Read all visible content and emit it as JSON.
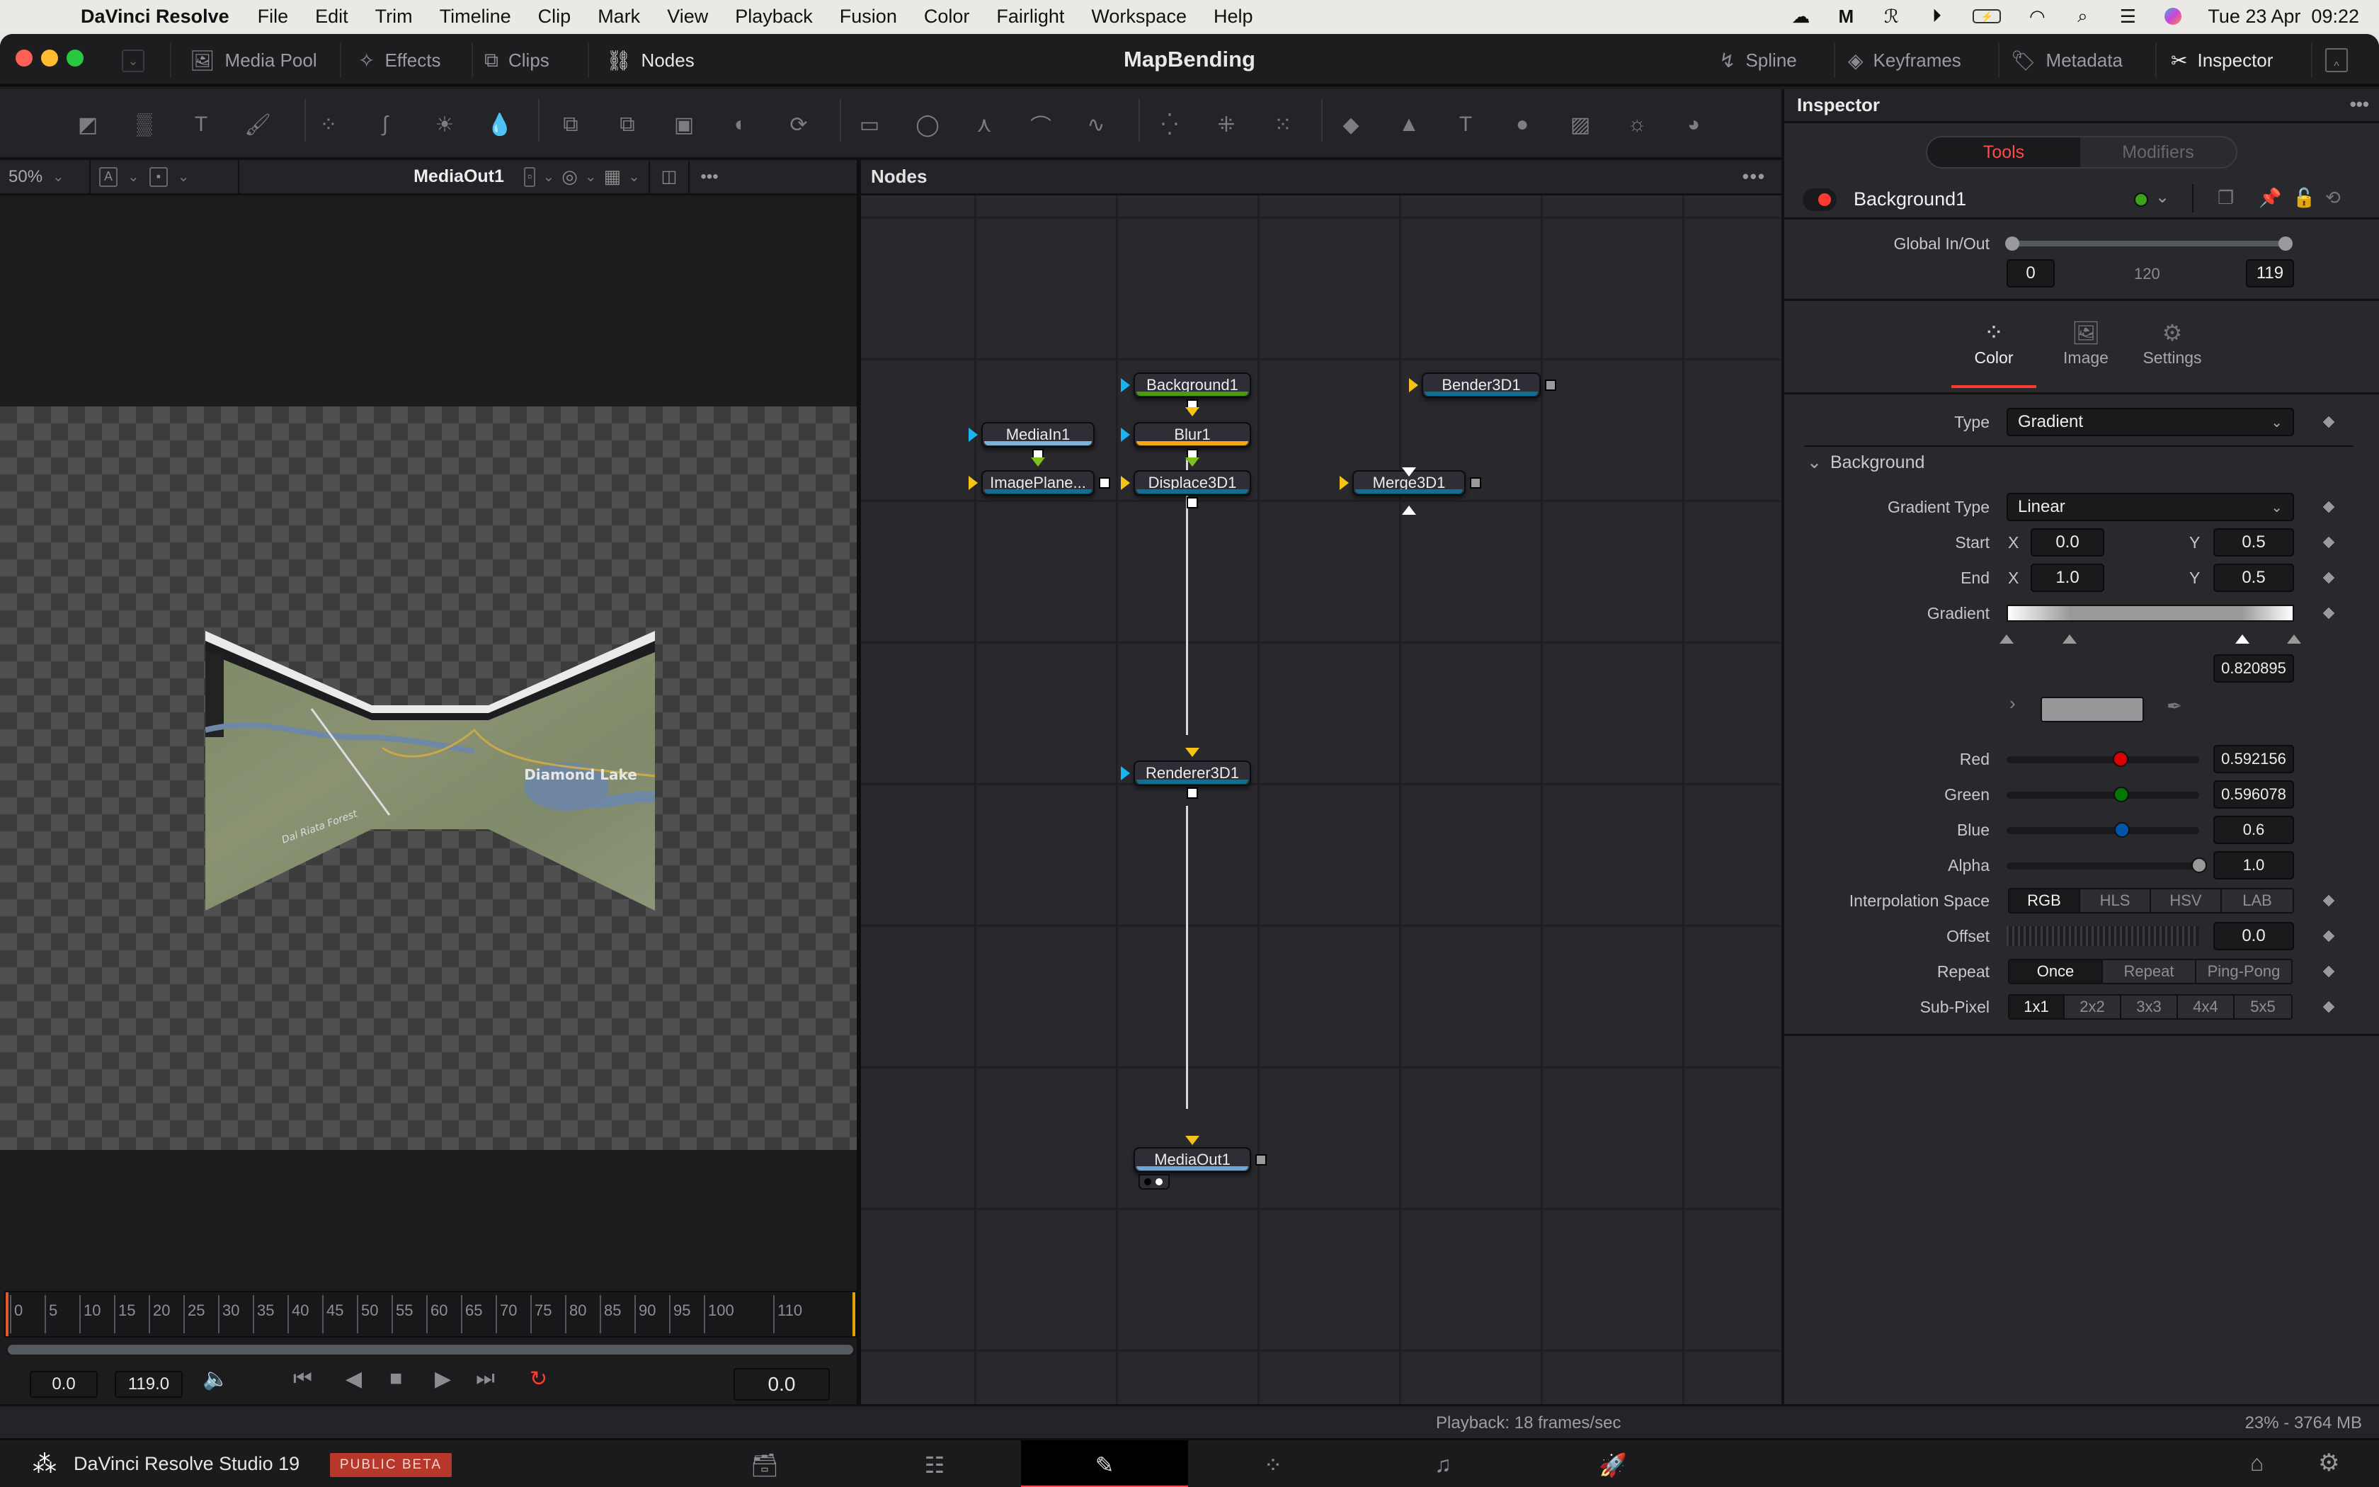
{
  "menubar": {
    "app": "DaVinci Resolve",
    "items": [
      "File",
      "Edit",
      "Trim",
      "Timeline",
      "Clip",
      "Mark",
      "View",
      "Playback",
      "Fusion",
      "Color",
      "Fairlight",
      "Workspace",
      "Help"
    ],
    "clock": "Tue 23 Apr  09:22",
    "status_icons": [
      "cloud-icon",
      "m-logo-icon",
      "scribble-icon",
      "play-circle-icon",
      "battery-icon",
      "wifi-icon",
      "search-icon",
      "control-center-icon",
      "siri-icon"
    ]
  },
  "topbar": {
    "title": "MapBending",
    "left_buttons": [
      {
        "label": "Media Pool",
        "icon": "media-pool-icon"
      },
      {
        "label": "Effects",
        "icon": "effects-icon"
      },
      {
        "label": "Clips",
        "icon": "clips-icon"
      },
      {
        "label": "Nodes",
        "icon": "nodes-icon",
        "active": true
      }
    ],
    "right_buttons": [
      {
        "label": "Spline",
        "icon": "spline-icon"
      },
      {
        "label": "Keyframes",
        "icon": "keyframes-icon"
      },
      {
        "label": "Metadata",
        "icon": "metadata-icon"
      },
      {
        "label": "Inspector",
        "icon": "inspector-icon",
        "active": true
      }
    ]
  },
  "toolbar": {
    "tools": [
      "background-tool",
      "fast-noise-tool",
      "text-tool",
      "paint-tool",
      "color-corrector-tool",
      "color-curves-tool",
      "brightness-contrast-tool",
      "matte-control-tool",
      "merge-tool",
      "dissolve-tool",
      "channel-booleans-tool",
      "matte-tool",
      "transform-swap-tool",
      "rectangle-mask-tool",
      "ellipse-mask-tool",
      "polygon-mask-tool",
      "bspline-mask-tool",
      "polyline-tool",
      "particle-emitter-tool",
      "particle-render-tool",
      "pixel-source-tool",
      "image-plane-3d-tool",
      "shape-3d-tool",
      "text-3d-tool",
      "merge-3d-tool",
      "camera-3d-tool",
      "spot-light-tool",
      "renderer-3d-tool"
    ]
  },
  "viewer": {
    "zoom": "50%",
    "name": "MediaOut1",
    "image_labels": [
      "Diamond Lake",
      "Dal Riata Forest"
    ]
  },
  "timeline": {
    "ticks": [
      "0",
      "5",
      "10",
      "15",
      "20",
      "25",
      "30",
      "35",
      "40",
      "45",
      "50",
      "55",
      "60",
      "65",
      "70",
      "75",
      "80",
      "85",
      "90",
      "95",
      "100",
      "110"
    ],
    "render_start": "0.0",
    "render_end": "119.0",
    "current_time": "0.0"
  },
  "nodes": {
    "title": "Nodes",
    "list": [
      {
        "name": "Background1",
        "bar": "#4c9a13"
      },
      {
        "name": "Bender3D1",
        "bar": "#0f6f94"
      },
      {
        "name": "MediaIn1",
        "bar": "#7fb2d8"
      },
      {
        "name": "Blur1",
        "bar": "#f5a613"
      },
      {
        "name": "ImagePlane...",
        "bar": "#0f6f94"
      },
      {
        "name": "Displace3D1",
        "bar": "#0f6f94"
      },
      {
        "name": "Merge3D1",
        "bar": "#0f6f94"
      },
      {
        "name": "Renderer3D1",
        "bar": "#0f6f94"
      },
      {
        "name": "MediaOut1",
        "bar": "#6fa5d2"
      }
    ]
  },
  "inspector": {
    "title": "Inspector",
    "tabs": [
      "Tools",
      "Modifiers"
    ],
    "active_tab": "Tools",
    "tool_name": "Background1",
    "global_in_out": {
      "label": "Global In/Out",
      "in": "0",
      "duration": "120",
      "out": "119"
    },
    "sub_tabs": [
      "Color",
      "Image",
      "Settings"
    ],
    "active_sub_tab": "Color",
    "type": {
      "label": "Type",
      "value": "Gradient"
    },
    "section": "Background",
    "gradient_type": {
      "label": "Gradient Type",
      "value": "Linear"
    },
    "start": {
      "label": "Start",
      "x": "0.0",
      "y": "0.5"
    },
    "end": {
      "label": "End",
      "x": "1.0",
      "y": "0.5"
    },
    "gradient": {
      "label": "Gradient",
      "stop_position": "0.820895",
      "stops": [
        0.0,
        0.22,
        0.82,
        1.0
      ]
    },
    "red": {
      "label": "Red",
      "value": "0.592156",
      "fraction": 0.592
    },
    "green": {
      "label": "Green",
      "value": "0.596078",
      "fraction": 0.596
    },
    "blue": {
      "label": "Blue",
      "value": "0.6",
      "fraction": 0.6
    },
    "alpha": {
      "label": "Alpha",
      "value": "1.0",
      "fraction": 1.0
    },
    "interpolation": {
      "label": "Interpolation Space",
      "options": [
        "RGB",
        "HLS",
        "HSV",
        "LAB"
      ],
      "selected": "RGB"
    },
    "offset": {
      "label": "Offset",
      "value": "0.0"
    },
    "repeat": {
      "label": "Repeat",
      "options": [
        "Once",
        "Repeat",
        "Ping-Pong"
      ],
      "selected": "Once"
    },
    "subpixel": {
      "label": "Sub-Pixel",
      "options": [
        "1x1",
        "2x2",
        "3x3",
        "4x4",
        "5x5"
      ],
      "selected": "1x1"
    },
    "swatch_color": "#979899",
    "x_label": "X",
    "y_label": "Y"
  },
  "status": {
    "playback": "Playback: 18 frames/sec",
    "memory": "23% - 3764 MB"
  },
  "pagebar": {
    "product": "DaVinci Resolve Studio 19",
    "badge": "PUBLIC BETA",
    "pages": [
      "media-page",
      "cut-page",
      "edit-page",
      "fusion-page",
      "color-page",
      "fairlight-page",
      "deliver-page"
    ],
    "active_page": "fusion-page"
  },
  "colors": {
    "accent": "#ff4a4a",
    "badge": "#b7372a"
  }
}
